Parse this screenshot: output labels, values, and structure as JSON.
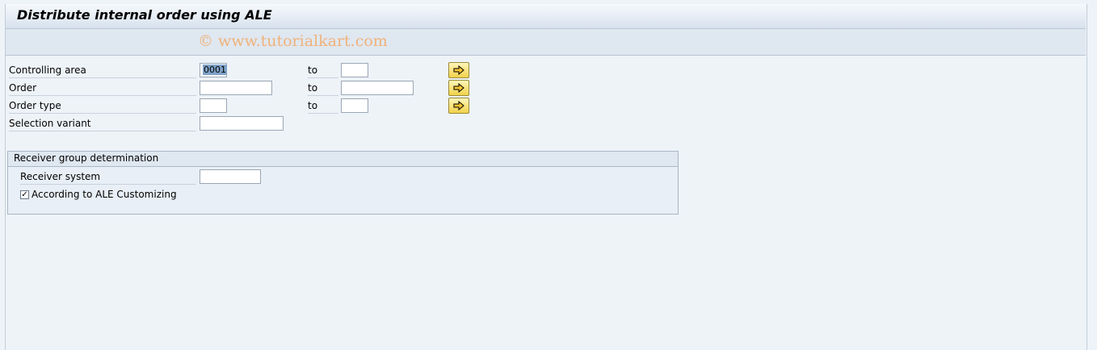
{
  "title": "Distribute internal order using ALE",
  "watermark": "© www.tutorialkart.com",
  "fields": {
    "controlling_area": {
      "label": "Controlling area",
      "value": "0001",
      "to": "to",
      "to_value": ""
    },
    "order": {
      "label": "Order",
      "value": "",
      "to": "to",
      "to_value": ""
    },
    "order_type": {
      "label": "Order type",
      "value": "",
      "to": "to",
      "to_value": ""
    },
    "selection_variant": {
      "label": "Selection variant",
      "value": ""
    }
  },
  "receiver_group": {
    "title": "Receiver group determination",
    "receiver_system_label": "Receiver system",
    "receiver_system_value": "",
    "checkbox_label": "According to ALE Customizing",
    "checkbox_checked": true
  },
  "icons": {
    "multiple_selection": "arrow-right-icon"
  }
}
